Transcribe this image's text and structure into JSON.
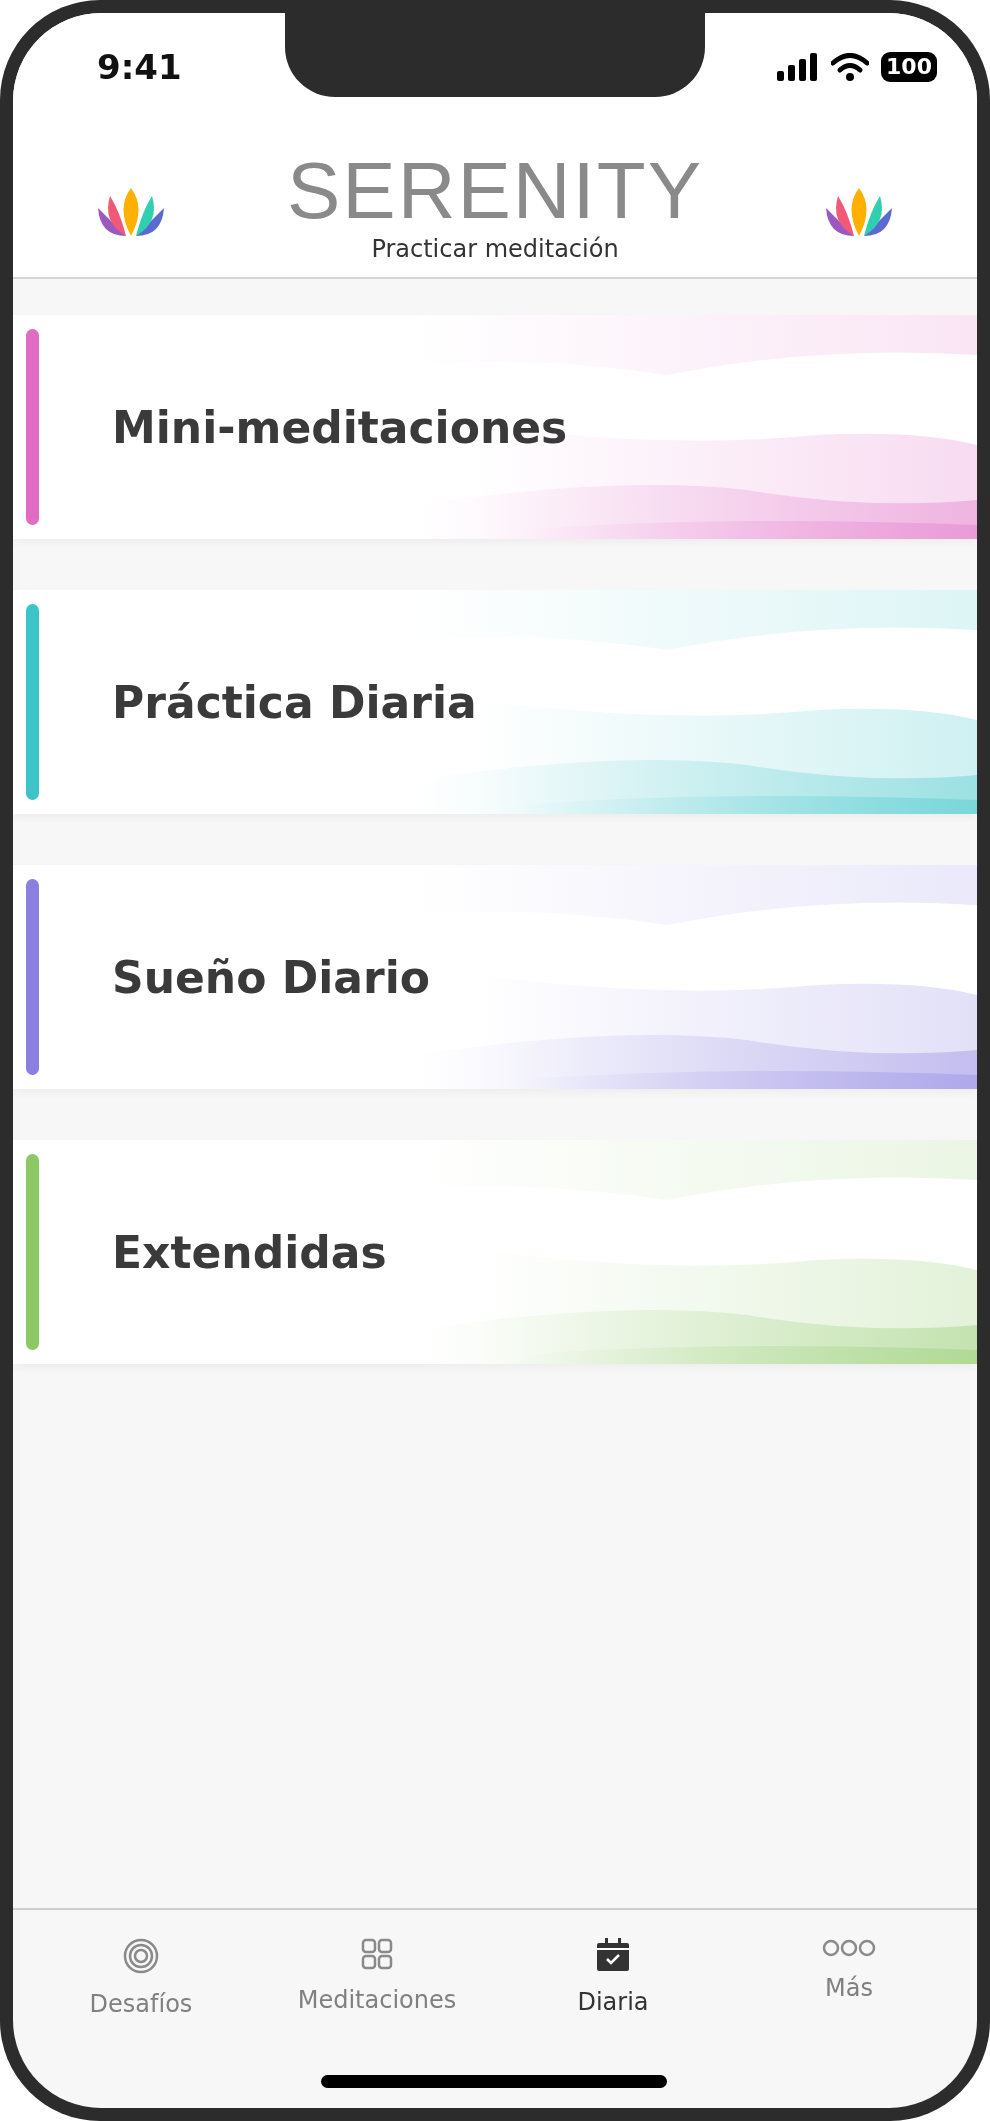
{
  "status_bar": {
    "time": "9:41",
    "battery": "100"
  },
  "header": {
    "title": "SERENITY",
    "subtitle": "Practicar meditación"
  },
  "categories": [
    {
      "title": "Mini-meditaciones",
      "color": "#e06cc4"
    },
    {
      "title": "Práctica Diaria",
      "color": "#3cc4c8"
    },
    {
      "title": "Sueño Diario",
      "color": "#8a80e0"
    },
    {
      "title": "Extendidas",
      "color": "#8cc864"
    }
  ],
  "tab_bar": [
    {
      "label": "Desafíos",
      "kind": "target",
      "selected": false
    },
    {
      "label": "Meditaciones",
      "kind": "grid",
      "selected": false
    },
    {
      "label": "Diaria",
      "kind": "calendar",
      "selected": true
    },
    {
      "label": "Más",
      "kind": "more",
      "selected": false
    }
  ]
}
